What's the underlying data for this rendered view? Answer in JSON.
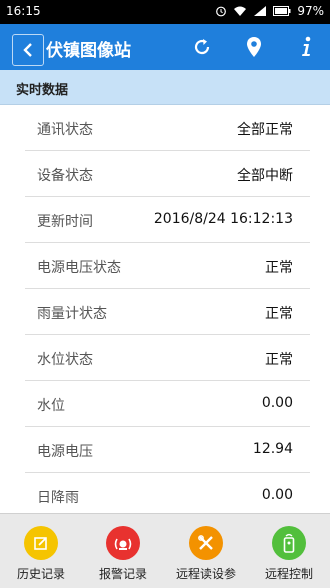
{
  "status_bar": {
    "time": "16:15",
    "battery": "97%"
  },
  "app_bar": {
    "title": "伏镇图像站",
    "icons": [
      "back-icon",
      "refresh-icon",
      "location-pin-icon",
      "info-icon"
    ]
  },
  "section": {
    "title": "实时数据"
  },
  "rows": [
    {
      "label": "通讯状态",
      "value": "全部正常"
    },
    {
      "label": "设备状态",
      "value": "全部中断"
    },
    {
      "label": "更新时间",
      "value": "2016/8/24 16:12:13"
    },
    {
      "label": "电源电压状态",
      "value": "正常"
    },
    {
      "label": "雨量计状态",
      "value": "正常"
    },
    {
      "label": "水位状态",
      "value": "正常"
    },
    {
      "label": "水位",
      "value": "0.00"
    },
    {
      "label": "电源电压",
      "value": "12.94"
    },
    {
      "label": "日降雨",
      "value": "0.00"
    }
  ],
  "bottom_nav": [
    {
      "label": "历史记录",
      "icon": "history-icon",
      "color": "#f5c400"
    },
    {
      "label": "报警记录",
      "icon": "alarm-icon",
      "color": "#e8322f"
    },
    {
      "label": "远程读设参",
      "icon": "tools-icon",
      "color": "#f39200"
    },
    {
      "label": "远程控制",
      "icon": "remote-control-icon",
      "color": "#52bf3c"
    }
  ],
  "colors": {
    "app_bar": "#1f7fdc",
    "section_header": "#c7e1f7"
  }
}
